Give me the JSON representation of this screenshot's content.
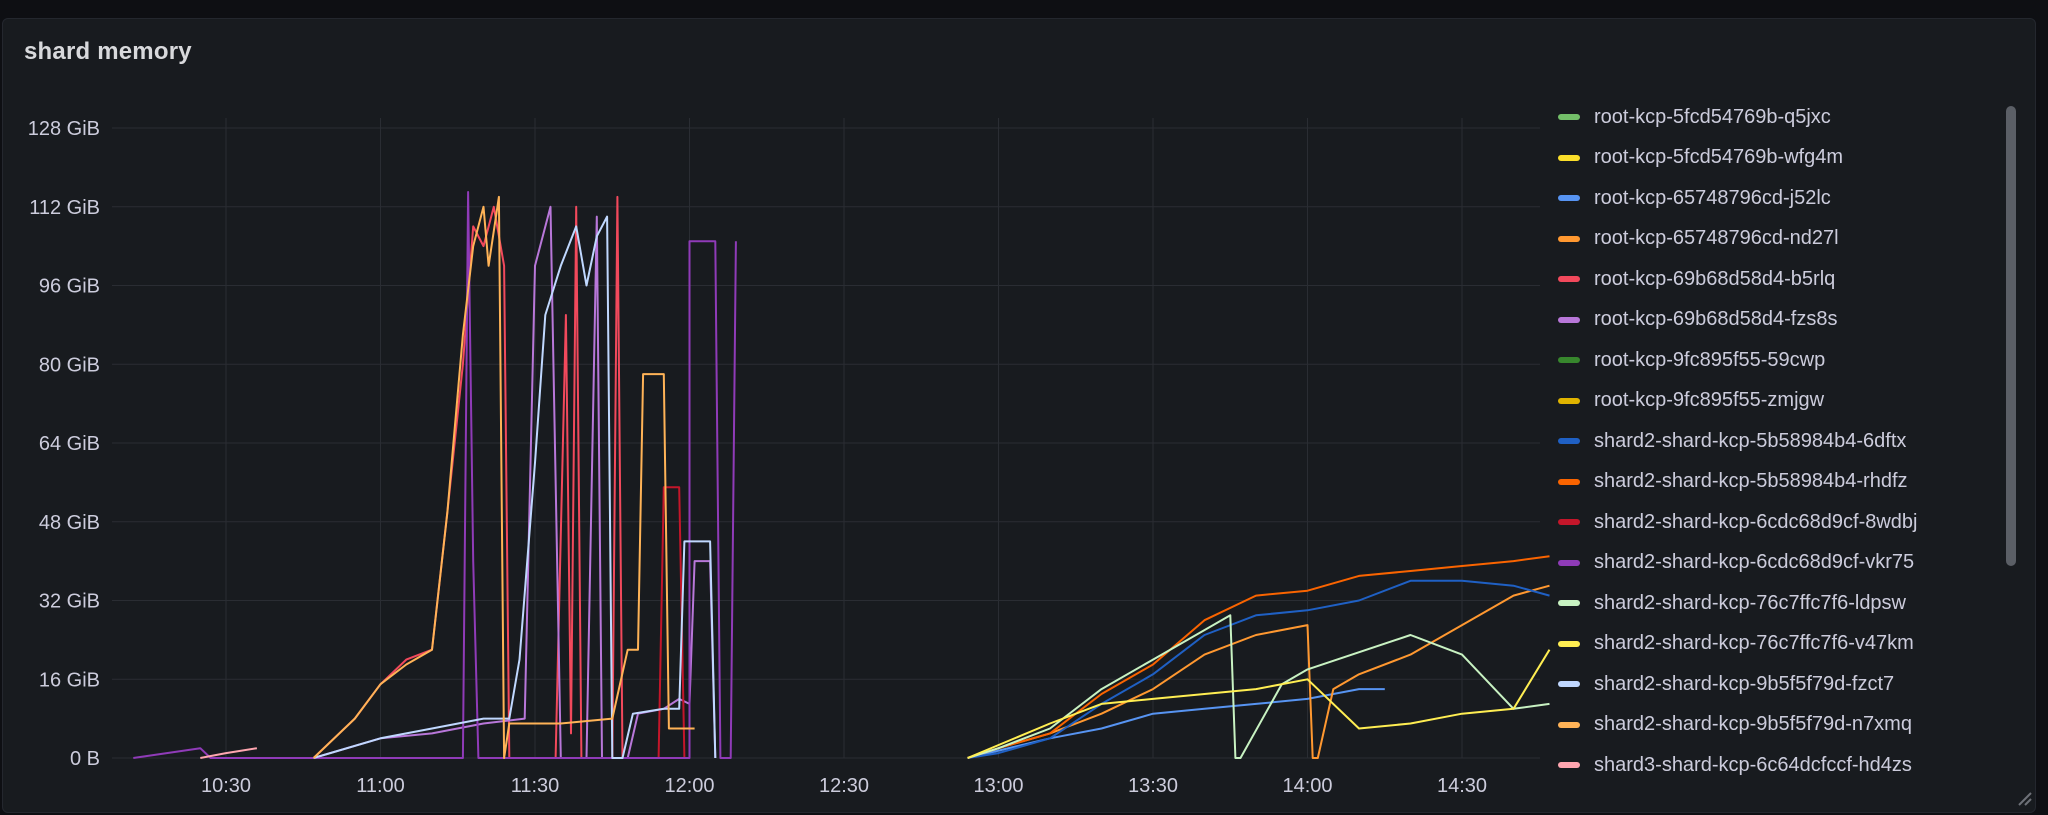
{
  "panel": {
    "title": "shard memory"
  },
  "chart_data": {
    "type": "line",
    "title": "shard memory",
    "xlabel": "",
    "ylabel": "",
    "xlim": [
      "10:12",
      "14:47"
    ],
    "ylim": [
      0,
      128
    ],
    "y_unit": "GiB",
    "y_ticks": [
      "0 B",
      "16 GiB",
      "32 GiB",
      "48 GiB",
      "64 GiB",
      "80 GiB",
      "96 GiB",
      "112 GiB",
      "128 GiB"
    ],
    "x_ticks": [
      "10:30",
      "11:00",
      "11:30",
      "12:00",
      "12:30",
      "13:00",
      "13:30",
      "14:00",
      "14:30"
    ],
    "grid": true,
    "legend_position": "right",
    "series": [
      {
        "name": "root-kcp-5fcd54769b-q5jxc",
        "color": "#73bf69",
        "points": []
      },
      {
        "name": "root-kcp-5fcd54769b-wfg4m",
        "color": "#fade2a",
        "points": []
      },
      {
        "name": "root-kcp-65748796cd-j52lc",
        "color": "#5794f2",
        "points": [
          [
            "12:54",
            0
          ],
          [
            "13:00",
            1.5
          ],
          [
            "13:10",
            4
          ],
          [
            "13:20",
            6
          ],
          [
            "13:30",
            9
          ],
          [
            "13:40",
            10
          ],
          [
            "13:50",
            11
          ],
          [
            "14:00",
            12
          ],
          [
            "14:10",
            14
          ],
          [
            "14:15",
            14
          ]
        ]
      },
      {
        "name": "root-kcp-65748796cd-nd27l",
        "color": "#ff9830",
        "points": [
          [
            "12:54",
            0
          ],
          [
            "13:00",
            2
          ],
          [
            "13:10",
            5
          ],
          [
            "13:20",
            9
          ],
          [
            "13:30",
            14
          ],
          [
            "13:40",
            21
          ],
          [
            "13:50",
            25
          ],
          [
            "14:00",
            27
          ],
          [
            "14:01",
            0
          ],
          [
            "14:02",
            0
          ],
          [
            "14:05",
            14
          ],
          [
            "14:10",
            17
          ],
          [
            "14:20",
            21
          ],
          [
            "14:30",
            27
          ],
          [
            "14:40",
            33
          ],
          [
            "14:47",
            35
          ]
        ]
      },
      {
        "name": "root-kcp-69b68d58d4-b5rlq",
        "color": "#f2495c",
        "points": [
          [
            "10:47",
            0
          ],
          [
            "10:50",
            3
          ],
          [
            "10:55",
            8
          ],
          [
            "11:00",
            15
          ],
          [
            "11:05",
            20
          ],
          [
            "11:10",
            22
          ],
          [
            "11:13",
            50
          ],
          [
            "11:16",
            80
          ],
          [
            "11:18",
            108
          ],
          [
            "11:20",
            104
          ],
          [
            "11:22",
            112
          ],
          [
            "11:24",
            100
          ],
          [
            "11:25",
            0
          ],
          [
            "11:34",
            0
          ],
          [
            "11:36",
            90
          ],
          [
            "11:37",
            5
          ],
          [
            "11:38",
            112
          ],
          [
            "11:39",
            0
          ],
          [
            "11:45",
            0
          ],
          [
            "11:46",
            114
          ],
          [
            "11:47",
            0
          ]
        ]
      },
      {
        "name": "root-kcp-69b68d58d4-fzs8s",
        "color": "#b877d9",
        "points": [
          [
            "10:47",
            0
          ],
          [
            "11:00",
            4
          ],
          [
            "11:10",
            5
          ],
          [
            "11:20",
            7
          ],
          [
            "11:28",
            8
          ],
          [
            "11:30",
            100
          ],
          [
            "11:33",
            112
          ],
          [
            "11:35",
            0
          ],
          [
            "11:40",
            0
          ],
          [
            "11:42",
            110
          ],
          [
            "11:43",
            0
          ],
          [
            "11:48",
            0
          ],
          [
            "11:50",
            9
          ],
          [
            "11:55",
            10
          ],
          [
            "11:58",
            12
          ],
          [
            "12:00",
            11
          ],
          [
            "12:01",
            40
          ],
          [
            "12:04",
            40
          ],
          [
            "12:05",
            0
          ]
        ]
      },
      {
        "name": "root-kcp-9fc895f55-59cwp",
        "color": "#37872d",
        "points": []
      },
      {
        "name": "root-kcp-9fc895f55-zmjgw",
        "color": "#e0b400",
        "points": []
      },
      {
        "name": "shard2-shard-kcp-5b58984b4-6dftx",
        "color": "#1f60c4",
        "points": [
          [
            "12:54",
            0
          ],
          [
            "13:00",
            1
          ],
          [
            "13:10",
            4
          ],
          [
            "13:20",
            11
          ],
          [
            "13:30",
            17
          ],
          [
            "13:40",
            25
          ],
          [
            "13:50",
            29
          ],
          [
            "14:00",
            30
          ],
          [
            "14:10",
            32
          ],
          [
            "14:20",
            36
          ],
          [
            "14:30",
            36
          ],
          [
            "14:40",
            35
          ],
          [
            "14:47",
            33
          ]
        ]
      },
      {
        "name": "shard2-shard-kcp-5b58984b4-rhdfz",
        "color": "#fa6400",
        "points": [
          [
            "12:54",
            0
          ],
          [
            "13:00",
            2
          ],
          [
            "13:10",
            5
          ],
          [
            "13:20",
            13
          ],
          [
            "13:30",
            19
          ],
          [
            "13:40",
            28
          ],
          [
            "13:50",
            33
          ],
          [
            "14:00",
            34
          ],
          [
            "14:10",
            37
          ],
          [
            "14:20",
            38
          ],
          [
            "14:30",
            39
          ],
          [
            "14:40",
            40
          ],
          [
            "14:47",
            41
          ]
        ]
      },
      {
        "name": "shard2-shard-kcp-6cdc68d9cf-8wdbj",
        "color": "#c4162a",
        "points": [
          [
            "11:54",
            0
          ],
          [
            "11:55",
            55
          ],
          [
            "11:58",
            55
          ],
          [
            "11:59",
            0
          ]
        ]
      },
      {
        "name": "shard2-shard-kcp-6cdc68d9cf-vkr75",
        "color": "#8f3bb8",
        "points": [
          [
            "10:12",
            0
          ],
          [
            "10:25",
            2
          ],
          [
            "10:27",
            0
          ],
          [
            "11:16",
            0
          ],
          [
            "11:17",
            115
          ],
          [
            "11:18",
            40
          ],
          [
            "11:19",
            0
          ],
          [
            "12:00",
            0
          ],
          [
            "12:00",
            105
          ],
          [
            "12:05",
            105
          ],
          [
            "12:06",
            0
          ],
          [
            "12:08",
            0
          ],
          [
            "12:09",
            105
          ]
        ]
      },
      {
        "name": "shard2-shard-kcp-76c7ffc7f6-ldpsw",
        "color": "#c8f2c2",
        "points": [
          [
            "12:54",
            0
          ],
          [
            "13:00",
            2
          ],
          [
            "13:10",
            6
          ],
          [
            "13:20",
            14
          ],
          [
            "13:30",
            20
          ],
          [
            "13:45",
            29
          ],
          [
            "13:46",
            0
          ],
          [
            "13:47",
            0
          ],
          [
            "13:55",
            15
          ],
          [
            "14:00",
            18
          ],
          [
            "14:20",
            25
          ],
          [
            "14:30",
            21
          ],
          [
            "14:40",
            10
          ],
          [
            "14:47",
            11
          ]
        ]
      },
      {
        "name": "shard2-shard-kcp-76c7ffc7f6-v47km",
        "color": "#ffee52",
        "points": [
          [
            "12:54",
            0
          ],
          [
            "13:10",
            7
          ],
          [
            "13:20",
            11
          ],
          [
            "13:30",
            12
          ],
          [
            "13:40",
            13
          ],
          [
            "13:50",
            14
          ],
          [
            "14:00",
            16
          ],
          [
            "14:10",
            6
          ],
          [
            "14:20",
            7
          ],
          [
            "14:30",
            9
          ],
          [
            "14:40",
            10
          ],
          [
            "14:47",
            22
          ]
        ]
      },
      {
        "name": "shard2-shard-kcp-9b5f5f79d-fzct7",
        "color": "#c0d8ff",
        "points": [
          [
            "10:47",
            0
          ],
          [
            "11:00",
            4
          ],
          [
            "11:10",
            6
          ],
          [
            "11:20",
            8
          ],
          [
            "11:25",
            8
          ],
          [
            "11:27",
            20
          ],
          [
            "11:30",
            60
          ],
          [
            "11:32",
            90
          ],
          [
            "11:35",
            100
          ],
          [
            "11:38",
            108
          ],
          [
            "11:40",
            96
          ],
          [
            "11:42",
            106
          ],
          [
            "11:44",
            110
          ],
          [
            "11:45",
            0
          ],
          [
            "11:47",
            0
          ],
          [
            "11:49",
            9
          ],
          [
            "11:55",
            10
          ],
          [
            "11:58",
            10
          ],
          [
            "11:59",
            44
          ],
          [
            "12:04",
            44
          ],
          [
            "12:05",
            0
          ]
        ]
      },
      {
        "name": "shard2-shard-kcp-9b5f5f79d-n7xmq",
        "color": "#ffb357",
        "points": [
          [
            "10:47",
            0
          ],
          [
            "10:55",
            8
          ],
          [
            "11:00",
            15
          ],
          [
            "11:05",
            19
          ],
          [
            "11:10",
            22
          ],
          [
            "11:13",
            50
          ],
          [
            "11:16",
            86
          ],
          [
            "11:18",
            104
          ],
          [
            "11:20",
            112
          ],
          [
            "11:21",
            100
          ],
          [
            "11:23",
            114
          ],
          [
            "11:24",
            0
          ],
          [
            "11:25",
            7
          ],
          [
            "11:35",
            7
          ],
          [
            "11:45",
            8
          ],
          [
            "11:48",
            22
          ],
          [
            "11:50",
            22
          ],
          [
            "11:51",
            78
          ],
          [
            "11:55",
            78
          ],
          [
            "11:56",
            6
          ],
          [
            "12:00",
            6
          ],
          [
            "12:01",
            6
          ]
        ]
      },
      {
        "name": "shard3-shard-kcp-6c64dcfccf-hd4zs",
        "color": "#ffa6b0",
        "points": [
          [
            "10:25",
            0
          ],
          [
            "10:30",
            1
          ],
          [
            "10:36",
            2
          ]
        ]
      }
    ]
  },
  "icons": {
    "resize": "resize-corner-icon"
  }
}
